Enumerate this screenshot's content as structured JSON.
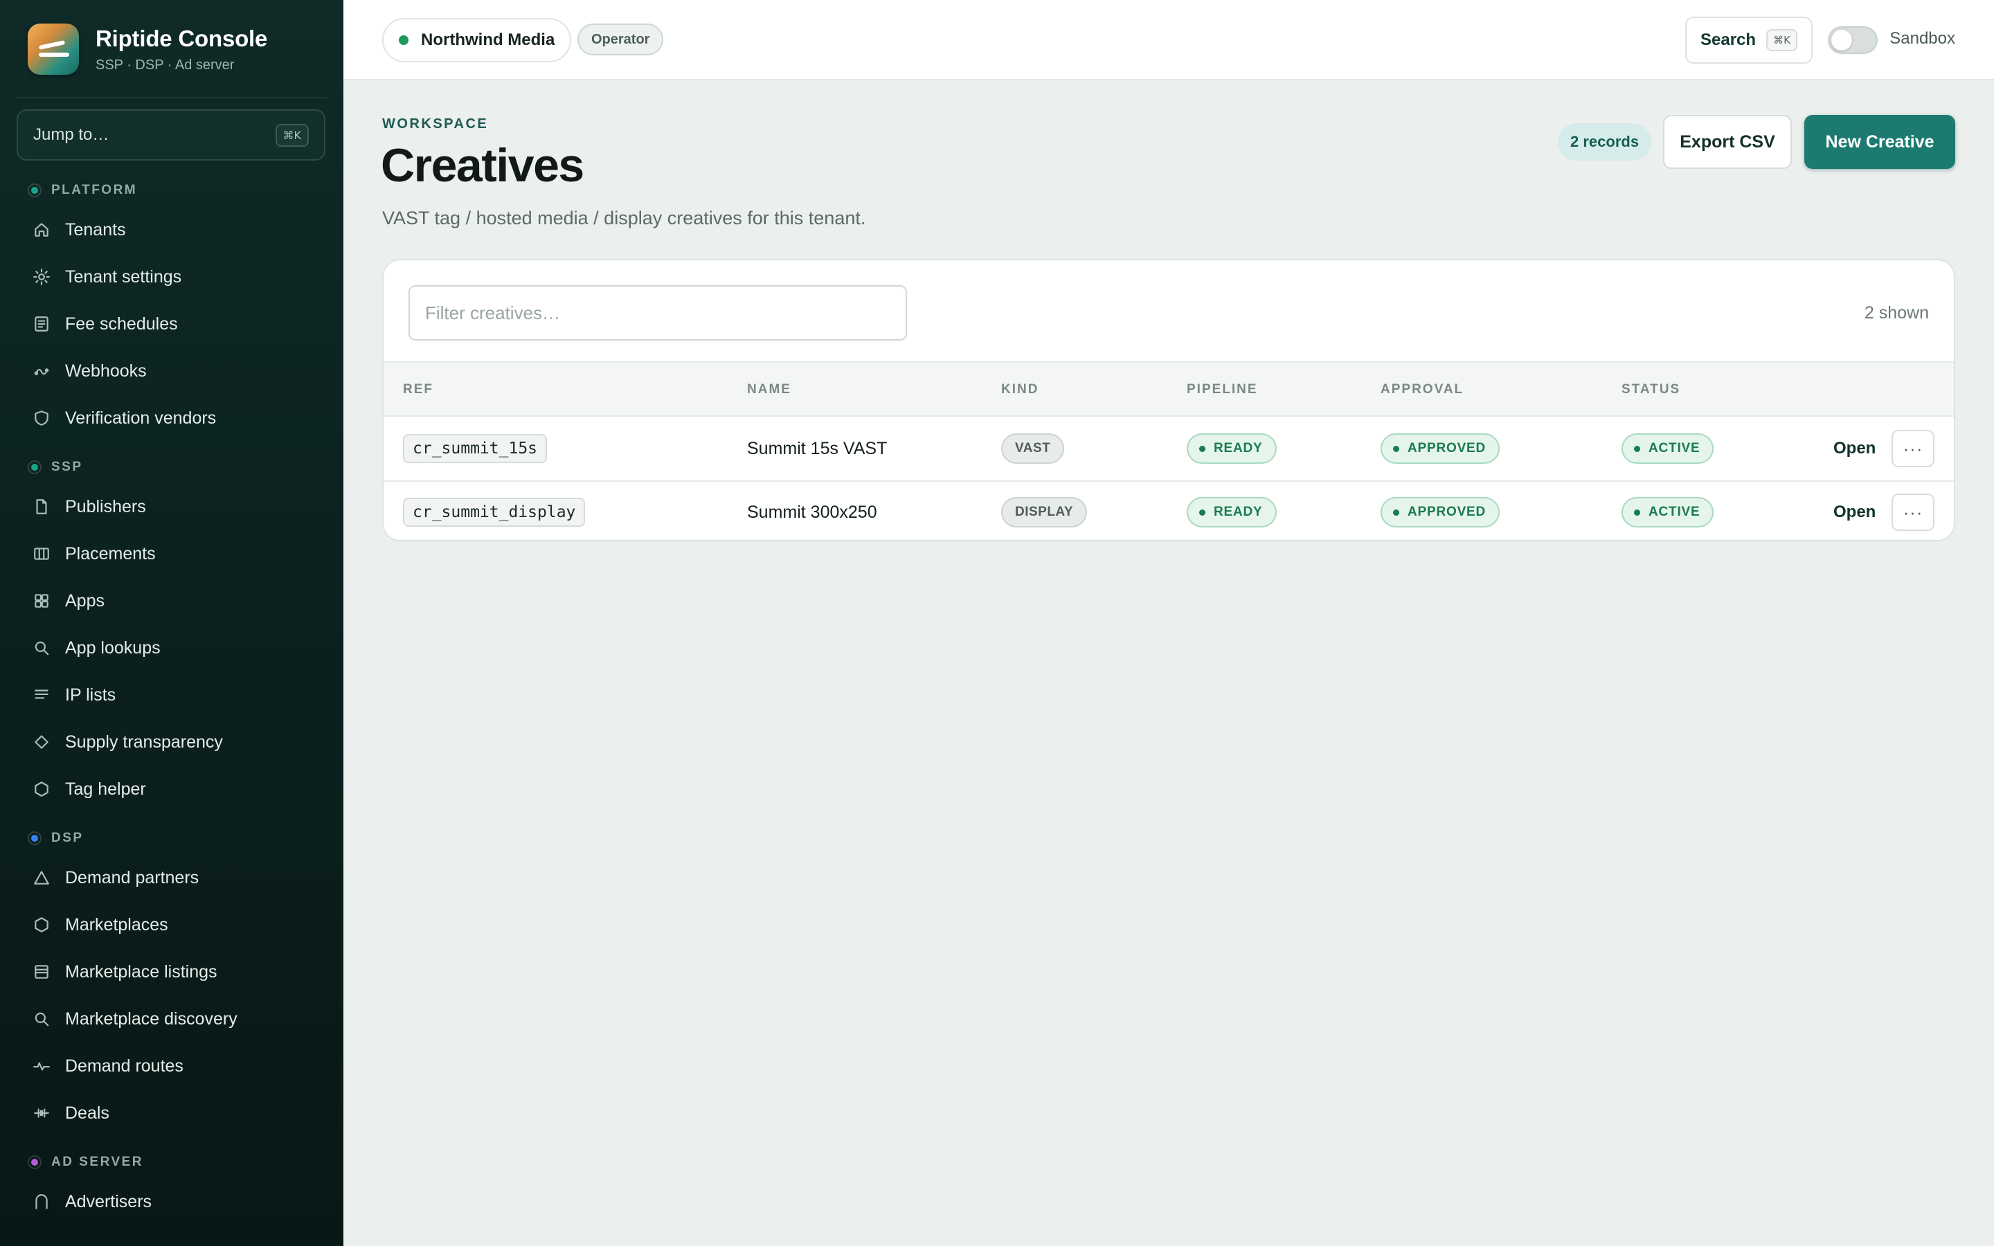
{
  "app": {
    "title": "Riptide Console",
    "subtitle": "SSP · DSP · Ad server"
  },
  "jump": {
    "label": "Jump to…",
    "shortcut": "⌘K"
  },
  "nav": {
    "sections": [
      {
        "label": "PLATFORM",
        "color": "#19a58c",
        "items": [
          {
            "label": "Tenants",
            "icon": "home-icon"
          },
          {
            "label": "Tenant settings",
            "icon": "gear-icon"
          },
          {
            "label": "Fee schedules",
            "icon": "document-icon"
          },
          {
            "label": "Webhooks",
            "icon": "webhook-icon"
          },
          {
            "label": "Verification vendors",
            "icon": "shield-icon"
          }
        ]
      },
      {
        "label": "SSP",
        "color": "#19a58c",
        "items": [
          {
            "label": "Publishers",
            "icon": "file-icon"
          },
          {
            "label": "Placements",
            "icon": "columns-icon"
          },
          {
            "label": "Apps",
            "icon": "grid-icon"
          },
          {
            "label": "App lookups",
            "icon": "search-icon"
          },
          {
            "label": "IP lists",
            "icon": "list-icon"
          },
          {
            "label": "Supply transparency",
            "icon": "diamond-icon"
          },
          {
            "label": "Tag helper",
            "icon": "hexagon-icon"
          }
        ]
      },
      {
        "label": "DSP",
        "color": "#3b82f6",
        "items": [
          {
            "label": "Demand partners",
            "icon": "triangle-icon"
          },
          {
            "label": "Marketplaces",
            "icon": "hexagon-icon"
          },
          {
            "label": "Marketplace listings",
            "icon": "storefront-icon"
          },
          {
            "label": "Marketplace discovery",
            "icon": "search-icon"
          },
          {
            "label": "Demand routes",
            "icon": "pulse-icon"
          },
          {
            "label": "Deals",
            "icon": "handshake-icon"
          }
        ]
      },
      {
        "label": "AD SERVER",
        "color": "#b45cd6",
        "items": [
          {
            "label": "Advertisers",
            "icon": "arch-icon"
          }
        ]
      }
    ]
  },
  "topbar": {
    "tenant": "Northwind Media",
    "role": "Operator",
    "search_label": "Search",
    "search_shortcut": "⌘K",
    "sandbox_label": "Sandbox",
    "sandbox_on": false
  },
  "page": {
    "eyebrow": "WORKSPACE",
    "title": "Creatives",
    "description": "VAST tag / hosted media / display creatives for this tenant.",
    "records": "2 records",
    "export_label": "Export CSV",
    "new_label": "New Creative"
  },
  "table": {
    "filter_placeholder": "Filter creatives…",
    "shown": "2 shown",
    "columns": [
      "REF",
      "NAME",
      "KIND",
      "PIPELINE",
      "APPROVAL",
      "STATUS"
    ],
    "open_label": "Open",
    "more_label": "···",
    "rows": [
      {
        "ref": "cr_summit_15s",
        "name": "Summit 15s VAST",
        "kind": "VAST",
        "pipeline": "READY",
        "approval": "APPROVED",
        "status": "ACTIVE"
      },
      {
        "ref": "cr_summit_display",
        "name": "Summit 300x250",
        "kind": "DISPLAY",
        "pipeline": "READY",
        "approval": "APPROVED",
        "status": "ACTIVE"
      }
    ]
  },
  "colors": {
    "accent": "#1d7a70",
    "sidebar": "#0f2a27",
    "success": "#1a7b4d"
  }
}
